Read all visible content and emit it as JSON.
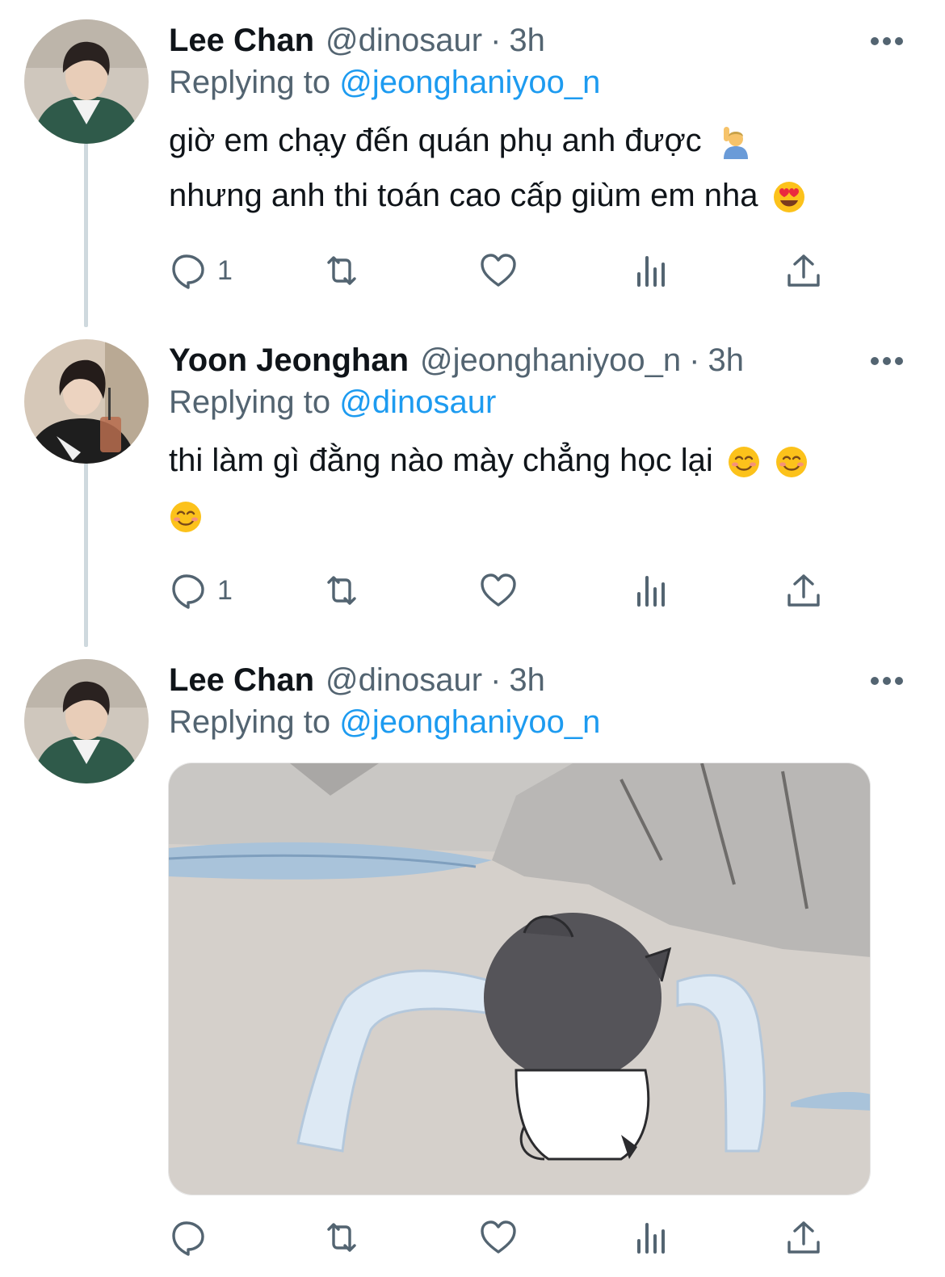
{
  "tweets": [
    {
      "name": "Lee Chan",
      "handle": "@dinosaur",
      "separator": "·",
      "time": "3h",
      "reply_prefix": "Replying to",
      "reply_to": "@jeonghaniyoo_n",
      "line1": "giờ em chạy đến quán phụ anh được",
      "line2": "nhưng anh thi toán cao cấp giùm em nha",
      "reply_count": "1"
    },
    {
      "name": "Yoon Jeonghan",
      "handle": "@jeonghaniyoo_n",
      "separator": "·",
      "time": "3h",
      "reply_prefix": "Replying to",
      "reply_to": "@dinosaur",
      "line1": "thi làm gì đằng nào mày chẳng học lại",
      "reply_count": "1"
    },
    {
      "name": "Lee Chan",
      "handle": "@dinosaur",
      "separator": "·",
      "time": "3h",
      "reply_prefix": "Replying to",
      "reply_to": "@jeonghaniyoo_n",
      "reply_count": ""
    }
  ],
  "icons": {
    "reply": "reply-icon",
    "retweet": "retweet-icon",
    "like": "heart-icon",
    "views": "views-icon",
    "share": "share-icon",
    "more": "more-icon"
  },
  "colors": {
    "link": "#1d9bf0",
    "muted": "#536471",
    "text": "#0f1419",
    "thread_line": "#cfd9de"
  }
}
